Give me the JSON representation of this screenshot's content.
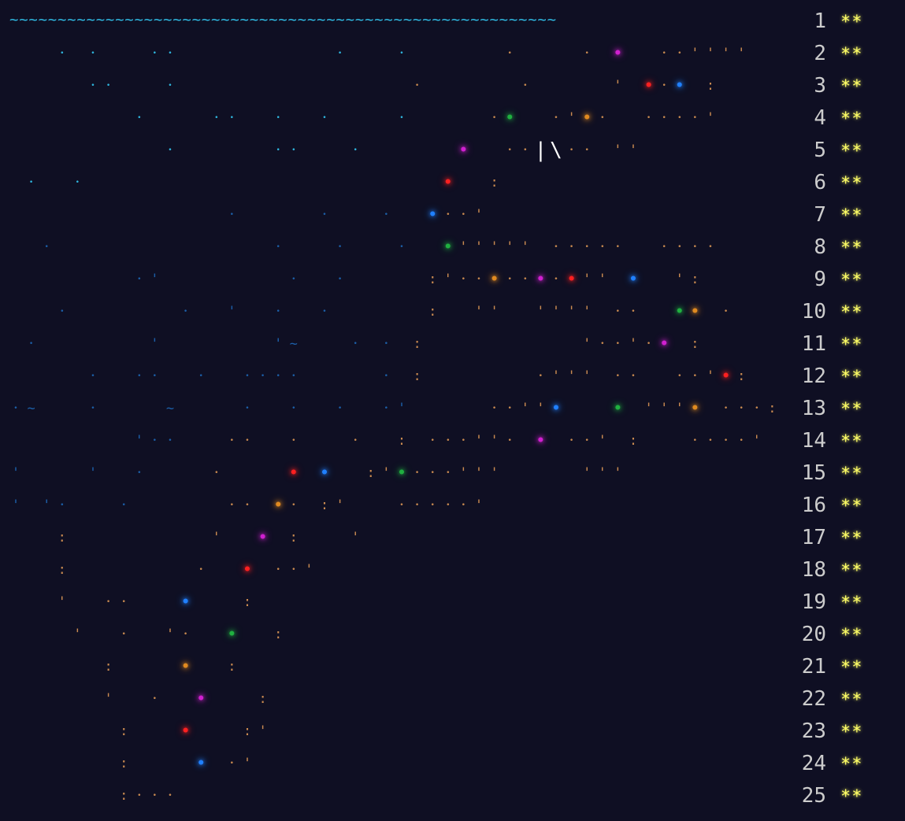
{
  "wave_line": "~~~~~~~~~~~~~~~~~~~~~~~~~~~~~~~~~~~~~~~~~~~~~~~~~~~~~~~~~",
  "colors": {
    "background": "#0f0f23",
    "gold": "#ffff66",
    "text": "#cccccc",
    "sea_light": "#2fb8e0",
    "sea_dark": "#1c5fa8",
    "sand": "#c98a50",
    "red": "#ff2020",
    "magenta": "#d020d0",
    "blue_light": "#2080ff",
    "green": "#20b040",
    "orange": "#e08a20",
    "white": "#ffffff"
  },
  "rows": [
    {
      "day": "1",
      "stars": "**"
    },
    {
      "day": "2",
      "stars": "**"
    },
    {
      "day": "3",
      "stars": "**"
    },
    {
      "day": "4",
      "stars": "**"
    },
    {
      "day": "5",
      "stars": "**"
    },
    {
      "day": "6",
      "stars": "**"
    },
    {
      "day": "7",
      "stars": "**"
    },
    {
      "day": "8",
      "stars": "**"
    },
    {
      "day": "9",
      "stars": "**"
    },
    {
      "day": "10",
      "stars": "**"
    },
    {
      "day": "11",
      "stars": "**"
    },
    {
      "day": "12",
      "stars": "**"
    },
    {
      "day": "13",
      "stars": "**"
    },
    {
      "day": "14",
      "stars": "**"
    },
    {
      "day": "15",
      "stars": "**"
    },
    {
      "day": "16",
      "stars": "**"
    },
    {
      "day": "17",
      "stars": "**"
    },
    {
      "day": "18",
      "stars": "**"
    },
    {
      "day": "19",
      "stars": "**"
    },
    {
      "day": "20",
      "stars": "**"
    },
    {
      "day": "21",
      "stars": "**"
    },
    {
      "day": "22",
      "stars": "**"
    },
    {
      "day": "23",
      "stars": "**"
    },
    {
      "day": "24",
      "stars": "**"
    },
    {
      "day": "25",
      "stars": "**"
    }
  ],
  "art_rows": [
    "",
    "   . .   ..          .   .      .    . *  ..'''' ",
    "     ..   .               .      .     ' *.* :   ",
    "        .    ..  .  .    .     .*  .'*.  ....'   ",
    "          .      ..   .      *  ..|\\.. ''       ",
    " .  .                       *  :                 ",
    "              .     .   .  *..'                  ",
    "  .              .   .   .  *''''' .....  ....   ",
    "        .'        .  .     :'..*..*.*'' *  ':    ",
    "   .       .  '  .  .      :  ''  '''' ..  ** .  ",
    " .       '       '~   . . :          '..'.* :    ",
    "     .  ..  .  ....     . :       .''' ..  ..'*: ",
    ".~   .    ~    .  .  .  .'     ..''*   * '''* ...:",
    "        '..   ..  .   .  : ...''. * ..' :   ....'",
    "'    '  .    .    * *  :'*...'''     '''         ",
    "' '.   .      .. *. :'   .....'                  ",
    "   :         '  * :   '                          ",
    "   :        .  * ..'                             ",
    "   '  ..   *   :                                 ",
    "    '  .  '.  *  :                               ",
    "      :    *  :                                  ",
    "      '  .  *   :                                ",
    "       :   *   :'                                ",
    "       :    * .'                                 ",
    "       :...                                      "
  ]
}
